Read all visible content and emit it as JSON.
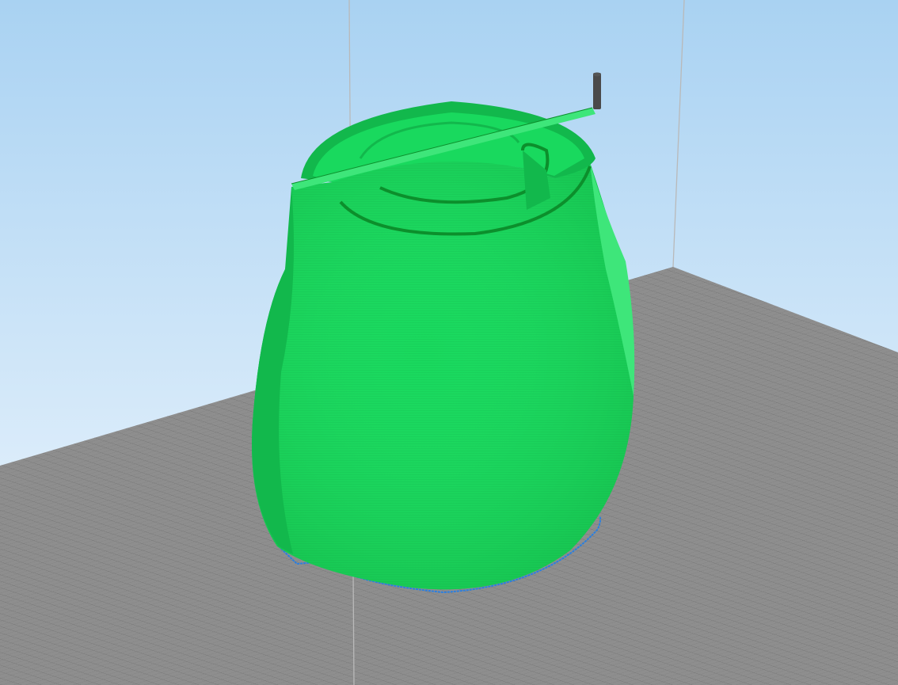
{
  "viewport": {
    "view": "3d-layer-preview",
    "colors": {
      "sky_top": "#a9d2f2",
      "sky_bottom": "#f2f8fe",
      "build_plate": "#8e8e8e",
      "grid_line": "#6e6e6e",
      "grid_major": "#555555",
      "volume_edge": "#b9b9b9",
      "model": "#19d95e",
      "model_dark": "#12b84c",
      "model_light": "#3ee67a",
      "layer_top_edge": "#0c8f2c",
      "skirt": "#2a7fe0",
      "nozzle": "#4a4a4a"
    },
    "objects": [
      {
        "name": "build-plate",
        "icon": "grid-plane"
      },
      {
        "name": "printed-model",
        "shape": "vase",
        "color_key": "model"
      },
      {
        "name": "skirt-outline",
        "color_key": "skirt"
      },
      {
        "name": "nozzle",
        "icon": "nozzle-rod"
      }
    ]
  }
}
